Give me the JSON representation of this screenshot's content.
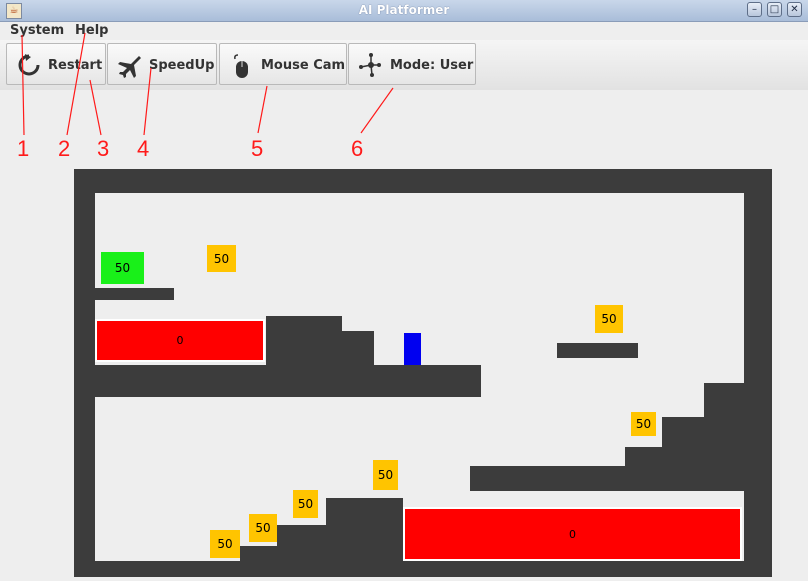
{
  "window": {
    "title": "AI Platformer"
  },
  "menus": [
    "System",
    "Help"
  ],
  "toolbar": {
    "restart_label": "Restart",
    "speedup_label": "SpeedUp",
    "mousecam_label": "Mouse Cam",
    "mode_label": "Mode: User"
  },
  "annotations": [
    "1",
    "2",
    "3",
    "4",
    "5",
    "6"
  ],
  "game": {
    "goal_value": "50",
    "coin_values": [
      "50",
      "50",
      "50",
      "50",
      "50",
      "50",
      "50",
      "50"
    ],
    "lava_values": [
      "0",
      "0"
    ]
  },
  "colors": {
    "wall": "#3c3c3c",
    "lava": "#ff0000",
    "coin": "#ffc400",
    "goal": "#19f019",
    "player": "#0000f0",
    "annotation": "#ff1a1a"
  }
}
